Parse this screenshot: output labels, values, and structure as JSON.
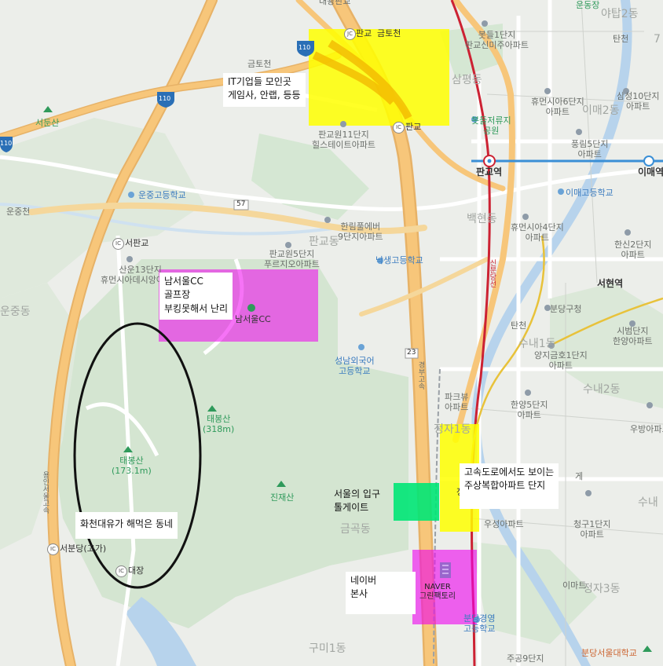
{
  "areas": {
    "sampyeong": "삼평동",
    "baekhyeon": "백현동",
    "pangyo": "판교동",
    "unjung": "운중동",
    "jeongja1": "정자1동",
    "geumgok": "금곡동",
    "gumi1": "구미1동",
    "sunae1": "수내1동",
    "sunae2": "수내2동",
    "sunae_cut": "수내",
    "jeongja3": "정자3동",
    "imae2": "이매2동",
    "yatap": "야탑2동",
    "ya7": "7",
    "top_partial": "대왕판교"
  },
  "roads": {
    "geumtocheon_top": "금토천",
    "geumtocheon_mid": "금토천",
    "unjungcheon": "운중천",
    "r110a": "110",
    "r110b": "110",
    "r110c": "110",
    "r57": "57",
    "r23": "23",
    "jc_pangyo": "판교",
    "ic_pangyo": "판교",
    "ic_seopangyo": "서판교",
    "ic_seobundang": "서분당(고가)",
    "ic_daejang": "대장",
    "gyeongbu": "경부고속",
    "bundang_line": "신분당선",
    "left_vertical": "용인서울고속",
    "tancheon_top": "탄천",
    "tancheon_mid": "탄천"
  },
  "stations": {
    "pangyo": "판교역",
    "imae": "이매역",
    "seohyeon": "서현역"
  },
  "places": [
    {
      "id": "bot-sinmiju",
      "text": "봇들1단지\n판교신미주아파트"
    },
    {
      "id": "heumsia6",
      "text": "휴먼시아6단지\n아파트"
    },
    {
      "id": "botdeul-park",
      "text": "봇들저류지\n공원"
    },
    {
      "id": "pungnim5",
      "text": "풍림5단지\n아파트"
    },
    {
      "id": "samsung10",
      "text": "삼성10단지\n아파트"
    },
    {
      "id": "imae-highschool",
      "text": "이매고등학교"
    },
    {
      "id": "heumsia4",
      "text": "휴먼시아4단지\n아파트"
    },
    {
      "id": "hansin2",
      "text": "한신2단지\n아파트"
    },
    {
      "id": "bundang-office",
      "text": "분당구청"
    },
    {
      "id": "sibeom",
      "text": "시범단지\n한양아파트"
    },
    {
      "id": "yangji",
      "text": "양지금호1단지\n아파트"
    },
    {
      "id": "hanyang5",
      "text": "한양5단지\n아파트"
    },
    {
      "id": "parkview",
      "text": "파크뷰\n아파트"
    },
    {
      "id": "ubang",
      "text": "우방아파트"
    },
    {
      "id": "woosung",
      "text": "우성아파트"
    },
    {
      "id": "cheonggu1",
      "text": "청구1단지\n아파트"
    },
    {
      "id": "imae-apt",
      "text": "이마트"
    },
    {
      "id": "bundang-gyeongyeong",
      "text": "분당경영\n고등학교"
    },
    {
      "id": "jugong9",
      "text": "주공9단지"
    },
    {
      "id": "bundang-seoul-univ",
      "text": "분당서울대학교"
    },
    {
      "id": "pangyo11",
      "text": "판교원11단지\n힐스테이트아파트"
    },
    {
      "id": "hanlim9",
      "text": "한림풀에버\n9단지아파트"
    },
    {
      "id": "pangyo5",
      "text": "판교원5단지\n푸르지오아파트"
    },
    {
      "id": "naksaeng",
      "text": "낙생고등학교"
    },
    {
      "id": "seongnam-foreign",
      "text": "성남외국어\n고등학교"
    },
    {
      "id": "unjung-high",
      "text": "운중고등학교"
    },
    {
      "id": "sanun13",
      "text": "산운13단지\n휴먼시아데시앙아파트"
    },
    {
      "id": "namseoul-cc",
      "text": "남서울CC"
    },
    {
      "id": "undongjang",
      "text": "운동장"
    },
    {
      "id": "top-partial",
      "text": "대왕판교"
    },
    {
      "id": "jeongja-partial",
      "text": "정"
    },
    {
      "id": "jeongja-partial2",
      "text": "게"
    }
  ],
  "mountains": [
    {
      "id": "seodunsan",
      "name": "서둔산"
    },
    {
      "id": "taebongsan-east",
      "name": "태봉산\n(318m)"
    },
    {
      "id": "taebongsan-west",
      "name": "태봉산\n(173.1m)"
    },
    {
      "id": "jinjaesan",
      "name": "진재산"
    }
  ],
  "annotations": {
    "it_companies": "IT기업들 모인곳\n게임사, 안랩, 등등",
    "golf": "남서울CC\n골프장\n부킹못해서 난리",
    "hwacheon": "화천대유가 해먹은 동네",
    "tollgate": "서울의 입구\n톨게이트",
    "highway_apts": "고속도로에서도 보이는\n주상복합아파트 단지",
    "naver_hq": "네이버\n본사",
    "naver_green": "NAVER\n그린팩토리"
  },
  "colors": {
    "land": "#eceeea",
    "green_area": "#cfe3cf",
    "highway": "#f7c67a",
    "highway_edge": "#e0a756",
    "road": "#ffffff",
    "water": "#b7d3ec",
    "yellow_highlight": "#ffff00",
    "magenta_highlight": "#ee00ee",
    "green_highlight": "#00e676",
    "circle": "#111111",
    "subway_red": "#cc2233",
    "subway_blue": "#3a8fd6"
  }
}
